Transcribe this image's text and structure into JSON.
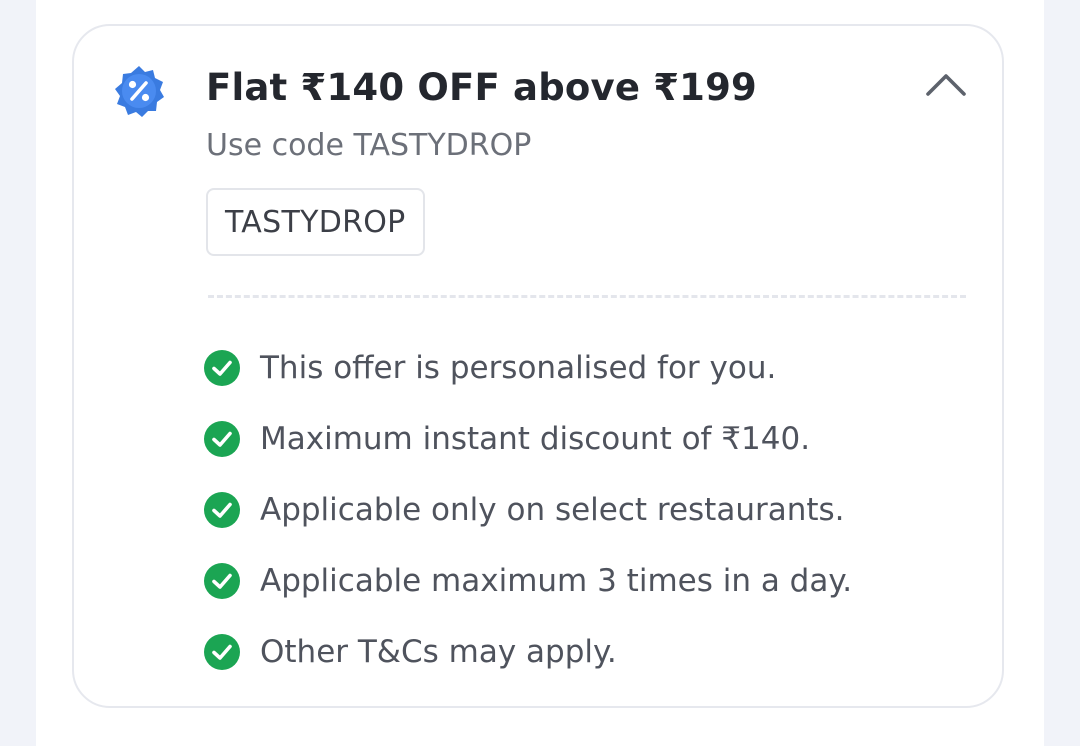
{
  "offer": {
    "title": "Flat ₹140 OFF above ₹199",
    "subtitle": "Use code TASTYDROP",
    "code": "TASTYDROP",
    "badge_icon": "discount-badge-icon",
    "expand_icon": "chevron-up-icon",
    "terms": [
      "This offer is personalised for you.",
      "Maximum instant discount of ₹140.",
      "Applicable only on select restaurants.",
      "Applicable maximum 3 times in a day.",
      "Other T&Cs may apply."
    ],
    "term_icon": "check-circle-icon"
  },
  "colors": {
    "badge_blue": "#3a7be0",
    "check_green": "#1ba553",
    "title_text": "#24272e",
    "muted_text": "#6c7079",
    "background": "#f1f3f9"
  }
}
